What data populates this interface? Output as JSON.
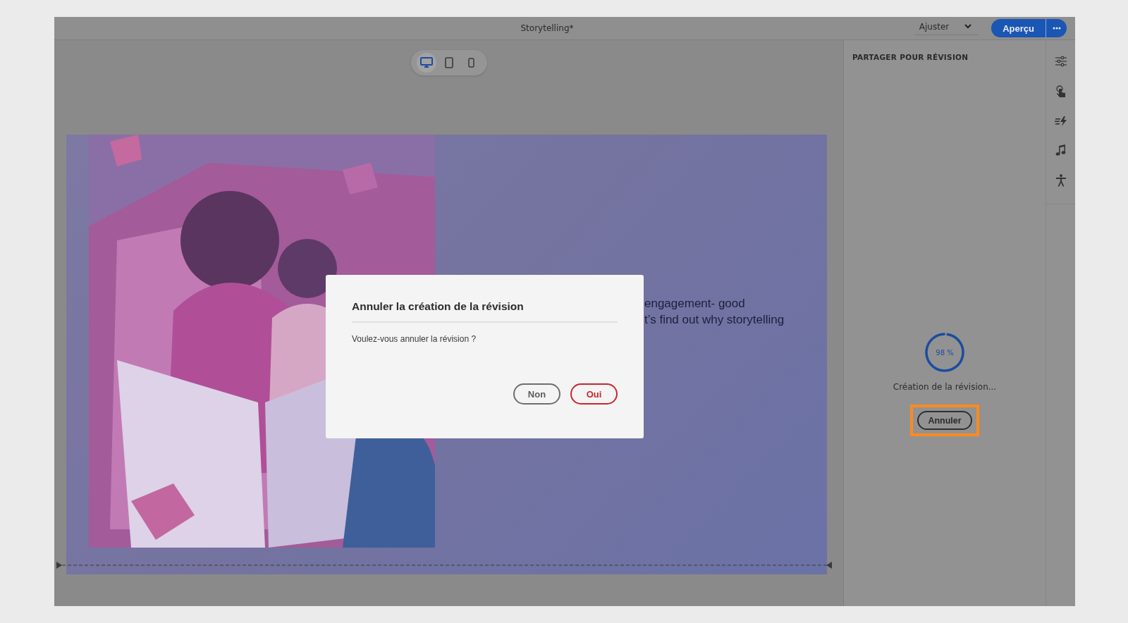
{
  "top_bar": {
    "title": "Storytelling*",
    "zoom": {
      "value": "Ajuster"
    },
    "preview_button": "Aperçu"
  },
  "device_toggles": [
    {
      "kind": "desktop",
      "selected": true
    },
    {
      "kind": "tablet",
      "selected": false
    },
    {
      "kind": "phone",
      "selected": false
    }
  ],
  "slide": {
    "text_lines": [
      "engagement- good",
      "t’s find out why storytelling"
    ]
  },
  "panel": {
    "title": "PARTAGER POUR RÉVISION",
    "progress": {
      "level": 0.98,
      "reading": "98 %"
    },
    "status": "Création de la révision...",
    "cancel_button": "Annuler",
    "cancel_highlighted": true
  },
  "rail": [
    {
      "kind": "properties"
    },
    {
      "kind": "interaction"
    },
    {
      "kind": "effects"
    },
    {
      "kind": "audio"
    },
    {
      "kind": "accessibility"
    }
  ],
  "dialog": {
    "title": "Annuler la création de la révision",
    "message": "Voulez-vous annuler la révision ?",
    "buttons": [
      {
        "label": "Non",
        "kind": "secondary"
      },
      {
        "label": "Oui",
        "kind": "negative"
      }
    ]
  }
}
